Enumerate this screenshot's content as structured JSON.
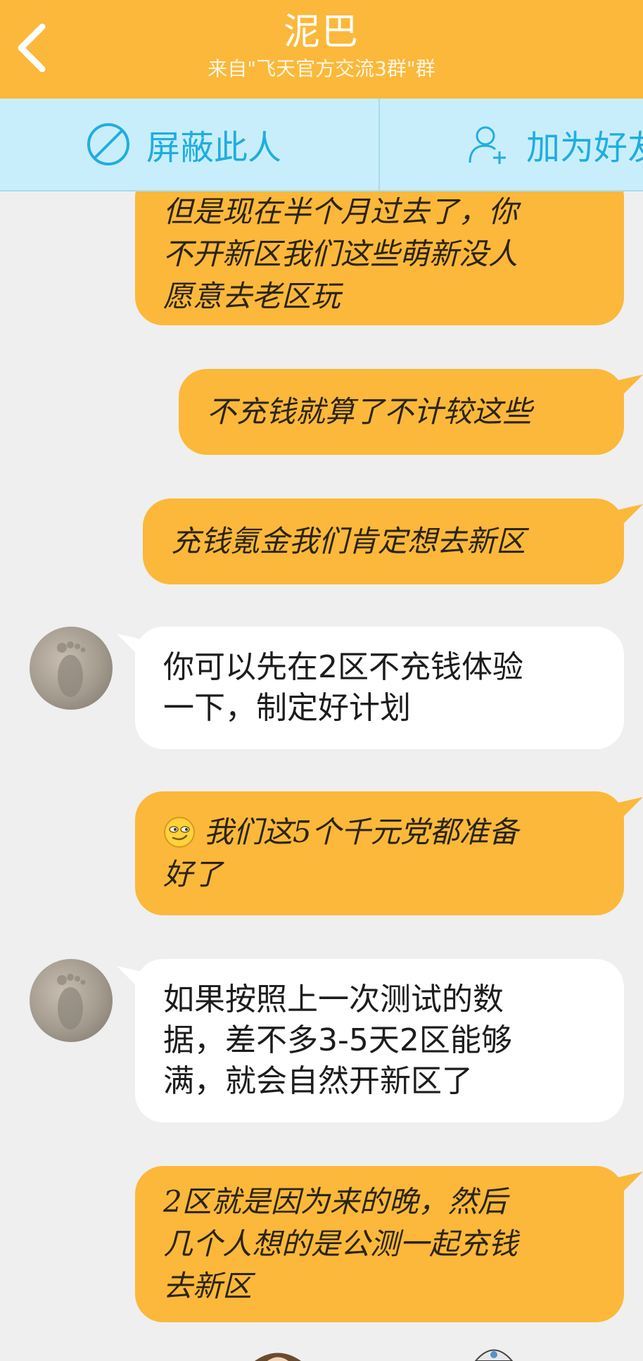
{
  "header": {
    "title": "泥巴",
    "subtitle": "来自\"飞天官方交流3群\"群"
  },
  "actions": {
    "block_label": "屏蔽此人",
    "add_friend_label": "加为好友"
  },
  "messages": [
    {
      "sender": "me",
      "lines": [
        "但是现在半个月过去了，你",
        "不开新区我们这些萌新没人",
        "愿意去老区玩"
      ]
    },
    {
      "sender": "me",
      "lines": [
        "不充钱就算了不计较这些"
      ]
    },
    {
      "sender": "me",
      "lines": [
        "充钱氪金我们肯定想去新区"
      ]
    },
    {
      "sender": "other",
      "lines": [
        "你可以先在2区不充钱体验",
        "一下，制定好计划"
      ]
    },
    {
      "sender": "me",
      "emoji": "smirk-emoji",
      "lines": [
        "我们这5个千元党都准备",
        "好了"
      ]
    },
    {
      "sender": "other",
      "lines": [
        "如果按照上一次测试的数",
        "据，差不多3-5天2区能够",
        "满，就会自然开新区了"
      ]
    },
    {
      "sender": "me",
      "lines": [
        "2区就是因为来的晚，然后",
        "几个人想的是公测一起充钱",
        "去新区"
      ]
    }
  ],
  "colors": {
    "header": "#fbb83a",
    "action_bar": "#c9eefb",
    "action_text": "#1faee0",
    "my_bubble": "#fbb83a",
    "their_bubble": "#ffffff",
    "background": "#efefef"
  }
}
